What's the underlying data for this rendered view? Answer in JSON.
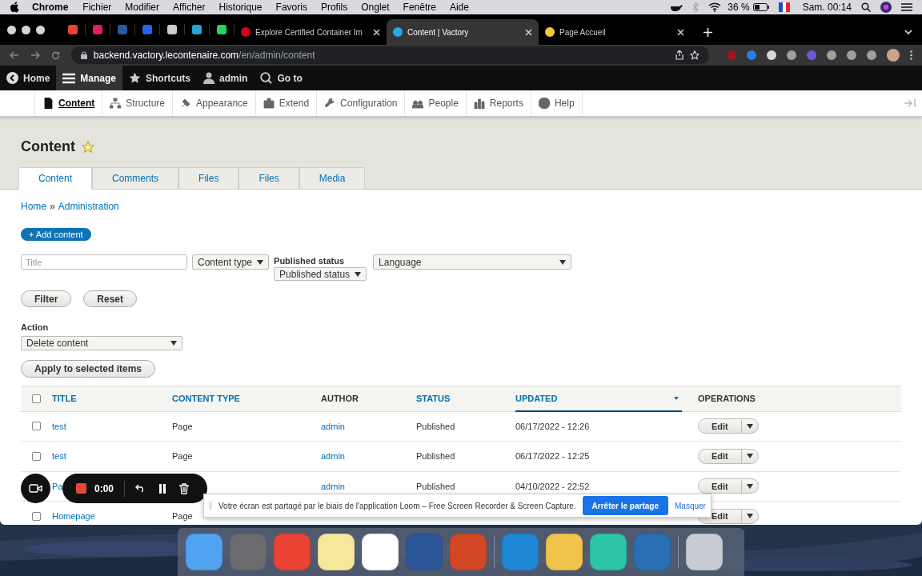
{
  "menubar": {
    "app": "Chrome",
    "items": [
      "Fichier",
      "Modifier",
      "Afficher",
      "Historique",
      "Favoris",
      "Profils",
      "Onglet",
      "Fenêtre",
      "Aide"
    ],
    "battery": "36 %",
    "clock": "Sam. 00:14"
  },
  "browser": {
    "tabs": [
      {
        "title": "Explore Certified Container Im",
        "selected": false
      },
      {
        "title": "Content | Vactory",
        "selected": true
      },
      {
        "title": "Page Accueil",
        "selected": false
      }
    ],
    "address": {
      "host": "backend.vactory.lecontenaire.com",
      "path": "/en/admin/content"
    }
  },
  "toolbar": {
    "items": [
      {
        "label": "Home",
        "selected": false
      },
      {
        "label": "Manage",
        "selected": true
      },
      {
        "label": "Shortcuts",
        "selected": false
      },
      {
        "label": "admin",
        "selected": false
      },
      {
        "label": "Go to",
        "selected": false
      }
    ]
  },
  "tray": {
    "items": [
      {
        "label": "Content",
        "selected": true
      },
      {
        "label": "Structure",
        "selected": false
      },
      {
        "label": "Appearance",
        "selected": false
      },
      {
        "label": "Extend",
        "selected": false
      },
      {
        "label": "Configuration",
        "selected": false
      },
      {
        "label": "People",
        "selected": false
      },
      {
        "label": "Reports",
        "selected": false
      },
      {
        "label": "Help",
        "selected": false
      }
    ]
  },
  "page": {
    "title": "Content",
    "tabs": [
      {
        "label": "Content",
        "selected": true
      },
      {
        "label": "Comments",
        "selected": false
      },
      {
        "label": "Files",
        "selected": false
      },
      {
        "label": "Files",
        "selected": false
      },
      {
        "label": "Media",
        "selected": false
      }
    ],
    "breadcrumb": [
      "Home",
      "Administration"
    ],
    "breadcrumb_separator": "»",
    "add_button": "+ Add content",
    "filters": {
      "title_placeholder": "Title",
      "content_type": "Content type",
      "status_label": "Published status",
      "status": "Published status",
      "language": "Language"
    },
    "filter_buttons": [
      "Filter",
      "Reset"
    ],
    "action": {
      "label": "Action",
      "value": "Delete content",
      "apply": "Apply to selected items"
    },
    "table": {
      "select_all_checked": false,
      "columns": [
        {
          "label": "TITLE",
          "sortable": true,
          "selected": false
        },
        {
          "label": "CONTENT TYPE",
          "sortable": true,
          "selected": false
        },
        {
          "label": "AUTHOR",
          "sortable": false,
          "selected": false
        },
        {
          "label": "STATUS",
          "sortable": true,
          "selected": false
        },
        {
          "label": "UPDATED",
          "sortable": true,
          "selected": true
        },
        {
          "label": "OPERATIONS",
          "sortable": false,
          "selected": false
        }
      ],
      "rows": [
        {
          "checked": false,
          "title": "test",
          "type": "Page",
          "author": "admin",
          "status": "Published",
          "updated": "06/17/2022 - 12:26",
          "operation": "Edit"
        },
        {
          "checked": false,
          "title": "test",
          "type": "Page",
          "author": "admin",
          "status": "Published",
          "updated": "06/17/2022 - 12:25",
          "operation": "Edit"
        },
        {
          "title": "Pa",
          "author": "admin",
          "status": "Published",
          "updated": "04/10/2022 - 22:52",
          "operation": "Edit"
        },
        {
          "checked": false,
          "title": "Homepage",
          "type": "Page",
          "operation": "Edit"
        }
      ]
    }
  },
  "recorder": {
    "timer": "0:00"
  },
  "share_banner": {
    "text": "Votre écran est partagé par le biais de l'application Loom – Free Screen Recorder & Screen Capture.",
    "stop": "Arrêter le partage",
    "hide": "Masquer"
  }
}
